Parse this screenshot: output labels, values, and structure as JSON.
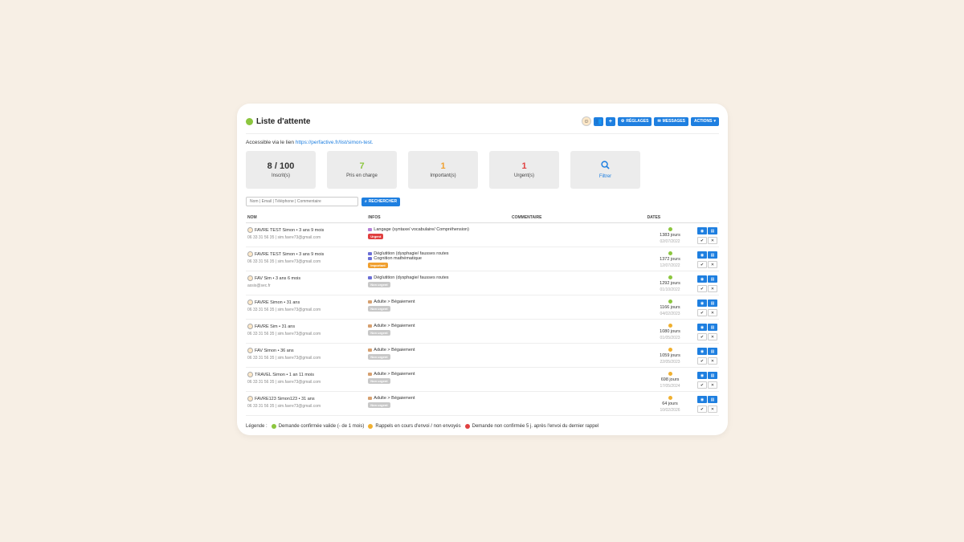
{
  "header": {
    "title": "Liste d'attente",
    "status_color": "#8cc63f",
    "buttons": {
      "users": "👥",
      "add": "+",
      "settings": "RÉGLAGES",
      "messages": "MESSAGES",
      "actions": "ACTIONS"
    }
  },
  "access": {
    "prefix": "Accessible via le lien",
    "link": "https://perfactive.fr/list/simon-test."
  },
  "stats": [
    {
      "value": "8 / 100",
      "label": "Inscrit(s)",
      "color": "#333333"
    },
    {
      "value": "7",
      "label": "Pris en charge",
      "color": "#8cc63f"
    },
    {
      "value": "1",
      "label": "Important(s)",
      "color": "#f0a030"
    },
    {
      "value": "1",
      "label": "Urgent(s)",
      "color": "#e04040"
    }
  ],
  "filter_label": "Filtrer",
  "search": {
    "placeholder": "Nom | Email | Téléphone | Commentaire",
    "button": "RECHERCHER"
  },
  "columns": {
    "name": "NOM",
    "infos": "INFOS",
    "comment": "COMMENTAIRE",
    "dates": "DATES"
  },
  "rows": [
    {
      "name": "FAVRE TEST Simon • 3 ans 9 mois",
      "contact": "06 33 31 56 35 | sim.favre73@gmail.com",
      "infos": [
        "Langage (syntaxe/ vocabulaire/ Compréhension)"
      ],
      "info_color": "#b57fd6",
      "badge": "Urgent",
      "badge_color": "#e04040",
      "dot": "#8cc63f",
      "days": "1383 jours",
      "date": "02/07/2022"
    },
    {
      "name": "FAVRE TEST Simon • 3 ans 9 mois",
      "contact": "06 33 31 56 35 | sim.favre73@gmail.com",
      "infos": [
        "Déglutition (dysphagie/ fausses routes",
        "Cognition mathématique"
      ],
      "info_color": "#6b6fd6",
      "badge": "Important",
      "badge_color": "#f0a030",
      "dot": "#8cc63f",
      "days": "1372 jours",
      "date": "12/07/2022"
    },
    {
      "name": "FAV Sim • 3 ans 6 mois",
      "contact": "assis@sec.fr",
      "infos": [
        "Déglutition (dysphagie/ fausses routes"
      ],
      "info_color": "#6b6fd6",
      "badge": "Non urgent",
      "badge_color": "#c8c8c8",
      "dot": "#8cc63f",
      "days": "1292 jours",
      "date": "01/10/2022"
    },
    {
      "name": "FAVRE Simon • 31 ans",
      "contact": "06 33 31 56 35 | sim.favre73@gmail.com",
      "infos": [
        "Adulte > Bégaiement"
      ],
      "info_color": "#d6a070",
      "badge": "Non urgent",
      "badge_color": "#c8c8c8",
      "dot": "#8cc63f",
      "days": "1166 jours",
      "date": "04/02/2023"
    },
    {
      "name": "FAVRE Sim • 31 ans",
      "contact": "06 33 31 56 35 | sim.favre73@gmail.com",
      "infos": [
        "Adulte > Bégaiement"
      ],
      "info_color": "#d6a070",
      "badge": "Non urgent",
      "badge_color": "#c8c8c8",
      "dot": "#f0b030",
      "days": "1080 jours",
      "date": "01/05/2023"
    },
    {
      "name": "FAV Simon • 36 ans",
      "contact": "06 33 31 56 35 | sim.favre73@gmail.com",
      "infos": [
        "Adulte > Bégaiement"
      ],
      "info_color": "#d6a070",
      "badge": "Non urgent",
      "badge_color": "#c8c8c8",
      "dot": "#f0b030",
      "days": "1059 jours",
      "date": "22/05/2023"
    },
    {
      "name": "TRAVEL Simon • 1 an 11 mois",
      "contact": "06 33 31 56 35 | sim.favre73@gmail.com",
      "infos": [
        "Adulte > Bégaiement"
      ],
      "info_color": "#d6a070",
      "badge": "Non urgent",
      "badge_color": "#c8c8c8",
      "dot": "#f0b030",
      "days": "698 jours",
      "date": "17/05/2024"
    },
    {
      "name": "FAVRE123 Simon123 • 31 ans",
      "contact": "06 33 31 56 35 | sim.favre73@gmail.com",
      "infos": [
        "Adulte > Bégaiement"
      ],
      "info_color": "#d6a070",
      "badge": "Non urgent",
      "badge_color": "#c8c8c8",
      "dot": "#f0b030",
      "days": "64 jours",
      "date": "10/02/2026"
    }
  ],
  "legend": {
    "label": "Légende :",
    "items": [
      {
        "text": "Demande confirmée valide (- de 1 mois)",
        "color": "#8cc63f"
      },
      {
        "text": "Rappels en cours d'envoi / non envoyés",
        "color": "#f0b030"
      },
      {
        "text": "Demande non confirmée 5 j. après l'envoi du dernier rappel",
        "color": "#e04040"
      }
    ]
  }
}
